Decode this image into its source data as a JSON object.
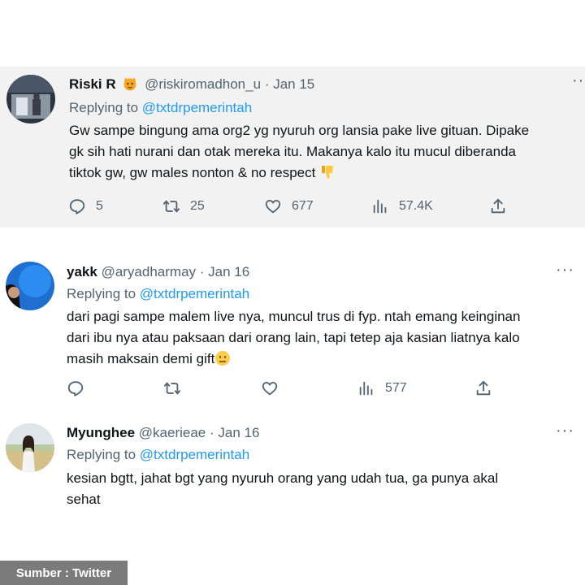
{
  "tweets": [
    {
      "name": "Riski R",
      "handle": "@riskiromadhon_u",
      "separator": "·",
      "date": "Jan 15",
      "replying_prefix": "Replying to",
      "replying_to": "@txtdrpemerintah",
      "text_lines": [
        "Gw sampe bingung ama org2 yg nyuruh org lansia pake live gituan. Dipake",
        "gk sih hati nurani dan otak mereka itu. Makanya kalo itu mucul diberanda",
        "tiktok gw, gw males nonton & no respect"
      ],
      "actions": {
        "replies": "5",
        "retweets": "25",
        "likes": "677",
        "views": "57.4K"
      }
    },
    {
      "name": "yakk",
      "handle": "@aryadharmay",
      "separator": "·",
      "date": "Jan 16",
      "replying_prefix": "Replying to",
      "replying_to": "@txtdrpemerintah",
      "text_lines": [
        "dari pagi sampe malem live nya, muncul trus di fyp. ntah emang keinginan",
        "dari ibu nya atau paksaan dari orang lain, tapi tetep aja kasian liatnya kalo",
        "masih maksain demi gift"
      ],
      "actions": {
        "views": "577"
      }
    },
    {
      "name": "Myunghee",
      "handle": "@kaerieae",
      "separator": "·",
      "date": "Jan 16",
      "replying_prefix": "Replying to",
      "replying_to": "@txtdrpemerintah",
      "text_lines": [
        "kesian bgtt, jahat bgt yang nyuruh orang yang udah tua, ga punya akal",
        "sehat"
      ]
    }
  ],
  "more_label": "···",
  "source_label": "Sumber : Twitter",
  "icons": [
    "reply-icon",
    "retweet-icon",
    "like-icon",
    "views-icon",
    "share-icon",
    "more-icon"
  ],
  "colors": {
    "mention": "#1d9bf0",
    "secondary": "#536471",
    "highlight_bg": "#f2f2f2",
    "source_bg": "#7b7b7b"
  }
}
